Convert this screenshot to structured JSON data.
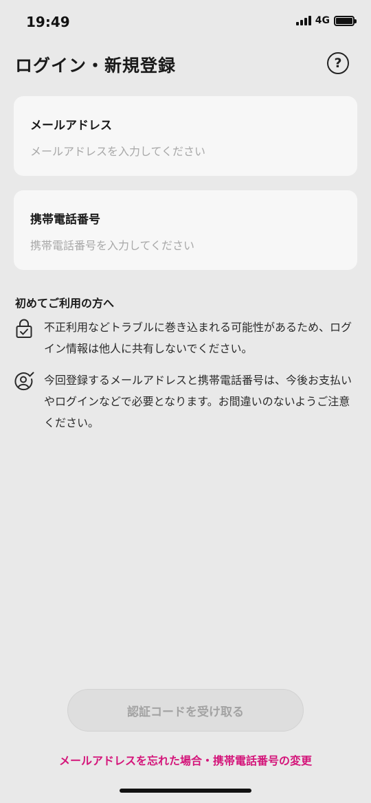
{
  "status_bar": {
    "time": "19:49",
    "network": "4G",
    "signal_icon": "signal-bars-icon",
    "battery_icon": "battery-full-icon"
  },
  "header": {
    "title": "ログイン・新規登録",
    "help_icon": "help-icon",
    "help_glyph": "?"
  },
  "form": {
    "email": {
      "label": "メールアドレス",
      "value": "",
      "placeholder": "メールアドレスを入力してください"
    },
    "phone": {
      "label": "携帯電話番号",
      "value": "",
      "placeholder": "携帯電話番号を入力してください"
    }
  },
  "notice": {
    "title": "初めてご利用の方へ",
    "items": [
      {
        "icon": "lock-check-icon",
        "text": "不正利用などトラブルに巻き込まれる可能性があるため、ログイン情報は他人に共有しないでください。"
      },
      {
        "icon": "user-check-icon",
        "text": "今回登録するメールアドレスと携帯電話番号は、今後お支払いやログインなどで必要となります。お間違いのないようご注意ください。"
      }
    ]
  },
  "actions": {
    "submit_label": "認証コードを受け取る",
    "submit_disabled": true,
    "forgot_label": "メールアドレスを忘れた場合・携帯電話番号の変更"
  },
  "colors": {
    "background": "#e9e9e9",
    "card": "#f7f7f7",
    "accent_link": "#d4157a",
    "disabled_button": "#dedede",
    "disabled_text": "#a3a3a3"
  }
}
